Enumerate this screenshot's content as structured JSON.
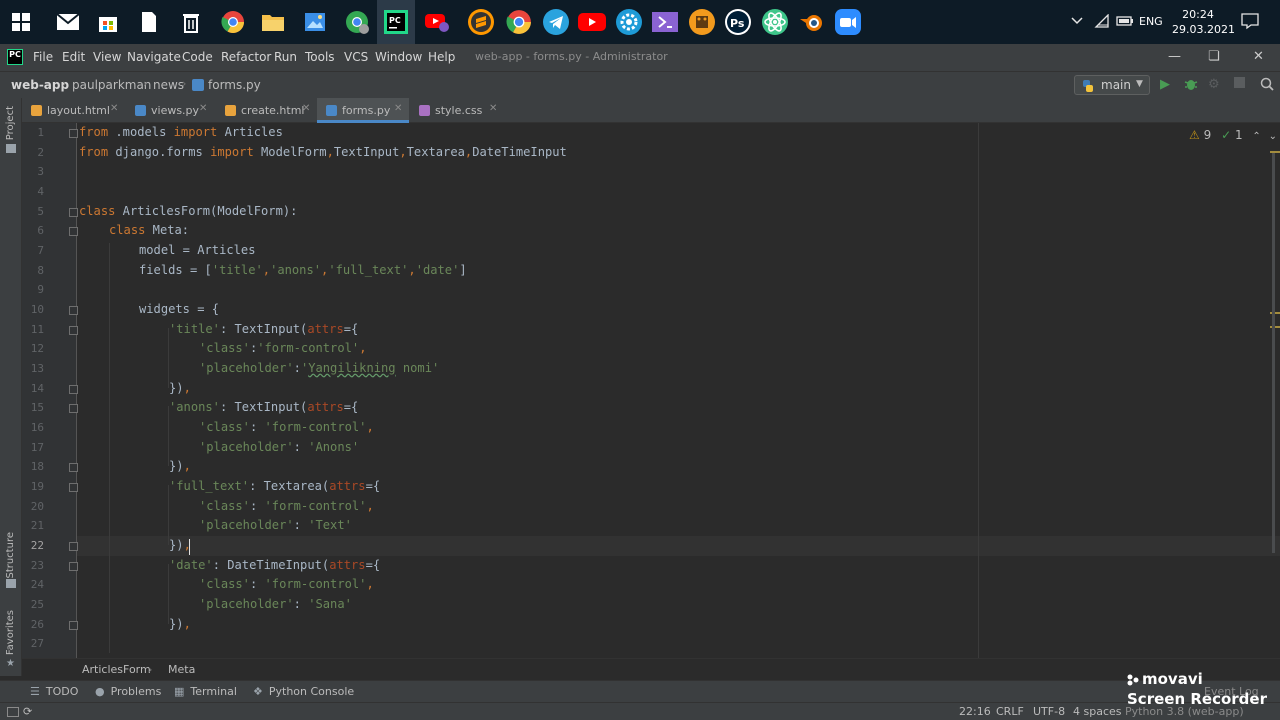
{
  "taskbar": {
    "clock_time": "20:24",
    "clock_date": "29.03.2021",
    "language": "ENG",
    "apps": [
      {
        "name": "windows-start-icon",
        "color": "#ffffff"
      },
      {
        "name": "mail-icon",
        "color": "#ffffff"
      },
      {
        "name": "store-icon",
        "color": "#ffffff"
      },
      {
        "name": "document-icon",
        "color": "#ffffff"
      },
      {
        "name": "trash-icon",
        "color": "#ffffff"
      },
      {
        "name": "chrome-icon",
        "color": "#e8453c"
      },
      {
        "name": "file-explorer-icon",
        "color": "#f5c04a"
      },
      {
        "name": "photos-icon",
        "color": "#3a8ee6"
      },
      {
        "name": "chrome-profile-icon",
        "color": "#34a853"
      },
      {
        "name": "pycharm-icon",
        "color": "#21d789"
      },
      {
        "name": "youtube-app-icon",
        "color": "#ff0000"
      },
      {
        "name": "sublime-icon",
        "color": "#ff9800"
      },
      {
        "name": "chrome-alt-icon",
        "color": "#e8453c"
      },
      {
        "name": "telegram-icon",
        "color": "#2aa3de"
      },
      {
        "name": "youtube-icon",
        "color": "#ff0000"
      },
      {
        "name": "settings-app-icon",
        "color": "#1e9bd7"
      },
      {
        "name": "visual-studio-icon",
        "color": "#8a63d2"
      },
      {
        "name": "app-icon",
        "color": "#f29a1d"
      },
      {
        "name": "photoshop-icon",
        "color": "#001e36"
      },
      {
        "name": "atom-icon",
        "color": "#3ec68a"
      },
      {
        "name": "blender-icon",
        "color": "#ea7600"
      },
      {
        "name": "zoom-icon",
        "color": "#2d8cff"
      }
    ]
  },
  "ide": {
    "menu": [
      "File",
      "Edit",
      "View",
      "Navigate",
      "Code",
      "Refactor",
      "Run",
      "Tools",
      "VCS",
      "Window",
      "Help"
    ],
    "window_title": "web-app - forms.py - Administrator",
    "breadcrumbs": [
      "web-app",
      "paulparkman",
      "news",
      "forms.py"
    ],
    "branch": "main",
    "tabs": [
      {
        "label": "layout.html",
        "active": false,
        "icon_color": "#e8a33d"
      },
      {
        "label": "views.py",
        "active": false,
        "icon_color": "#4a88c7"
      },
      {
        "label": "create.html",
        "active": false,
        "icon_color": "#e8a33d"
      },
      {
        "label": "forms.py",
        "active": true,
        "icon_color": "#4a88c7"
      },
      {
        "label": "style.css",
        "active": false,
        "icon_color": "#a971c2"
      }
    ],
    "left_strip": {
      "project": "Project",
      "structure": "Structure",
      "favorites": "Favorites"
    },
    "inspections": {
      "warnings": "9",
      "weak_warnings": "1"
    },
    "line_numbers": [
      "1",
      "2",
      "3",
      "4",
      "5",
      "6",
      "7",
      "8",
      "9",
      "10",
      "11",
      "12",
      "13",
      "14",
      "15",
      "16",
      "17",
      "18",
      "19",
      "20",
      "21",
      "22",
      "23",
      "24",
      "25",
      "26",
      "27"
    ],
    "current_line": "22",
    "code_breadcrumbs": [
      "ArticlesForm",
      "Meta"
    ],
    "tool_windows": [
      "TODO",
      "Problems",
      "Terminal",
      "Python Console"
    ],
    "status": {
      "position": "22:16",
      "line_sep": "CRLF",
      "encoding": "UTF-8",
      "indent": "4 spaces",
      "interpreter": "Python 3.8 (web-app)",
      "event_log": "Event Log"
    }
  },
  "code": {
    "l1": [
      "from",
      " .models ",
      "import",
      " Articles"
    ],
    "l2": [
      "from",
      " django.forms ",
      "import",
      " ModelForm",
      ",",
      "TextInput",
      ",",
      "Textarea",
      ",",
      "DateTimeInput"
    ],
    "l5": [
      "class",
      " ArticlesForm(ModelForm):"
    ],
    "l6": [
      "class",
      " Meta:"
    ],
    "l7": "model = Articles",
    "l8": [
      "fields = [",
      "'title'",
      ",",
      "'anons'",
      ",",
      "'full_text'",
      ",",
      "'date'",
      "]"
    ],
    "l10": "widgets = {",
    "l11": [
      "'title'",
      ": TextInput(",
      "attrs",
      "={"
    ],
    "l12": [
      "'class'",
      ":",
      "'form-control'",
      ","
    ],
    "l13": [
      "'placeholder'",
      ":",
      "'",
      "Yangilikning",
      " nomi'"
    ],
    "l14": [
      "})",
      ","
    ],
    "l15": [
      "'anons'",
      ": TextInput(",
      "attrs",
      "={"
    ],
    "l16": [
      "'class'",
      ": ",
      "'form-control'",
      ","
    ],
    "l17": [
      "'placeholder'",
      ": ",
      "'Anons'"
    ],
    "l18": [
      "})",
      ","
    ],
    "l19": [
      "'full_text'",
      ": Textarea(",
      "attrs",
      "={"
    ],
    "l20": [
      "'class'",
      ": ",
      "'form-control'",
      ","
    ],
    "l21": [
      "'placeholder'",
      ": ",
      "'Text'"
    ],
    "l22": [
      "})",
      ","
    ],
    "l23": [
      "'date'",
      ": DateTimeInput(",
      "attrs",
      "={"
    ],
    "l24": [
      "'class'",
      ": ",
      "'form-control'",
      ","
    ],
    "l25": [
      "'placeholder'",
      ": ",
      "'Sana'"
    ],
    "l26": [
      "})",
      ","
    ]
  },
  "watermark": {
    "brand": "movavi",
    "product": "Screen Recorder"
  }
}
